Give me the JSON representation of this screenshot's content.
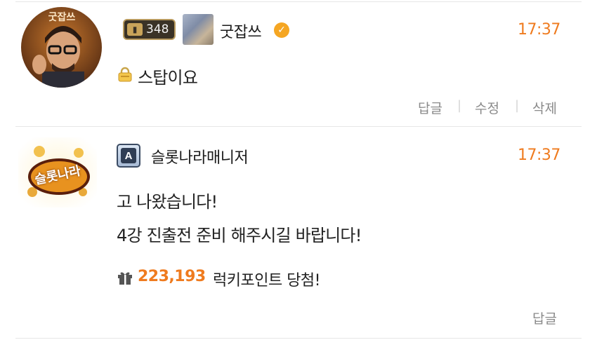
{
  "comments": [
    {
      "level": "348",
      "author": "굿잡쓰",
      "time": "17:37",
      "avatar_label": "굿잡쓰",
      "message": "스탑이요",
      "actions": {
        "reply": "답글",
        "edit": "수정",
        "delete": "삭제"
      }
    },
    {
      "avatar_label": "슬롯나라",
      "badge_letter": "A",
      "author": "슬롯나라매니저",
      "time": "17:37",
      "message_line1": "고 나왔습니다!",
      "message_line2": "4강 진출전 준비 해주시길 바랍니다!",
      "lucky_points": "223,193",
      "lucky_text": "럭키포인트 당첨!",
      "actions": {
        "reply": "답글"
      }
    }
  ],
  "colors": {
    "accent": "#ef7b1f",
    "divider": "#e6e6e6",
    "muted": "#8a8a8a"
  },
  "icons": [
    "lock-icon",
    "verified-icon",
    "gift-icon",
    "level-badge-icon",
    "manager-badge-icon"
  ]
}
